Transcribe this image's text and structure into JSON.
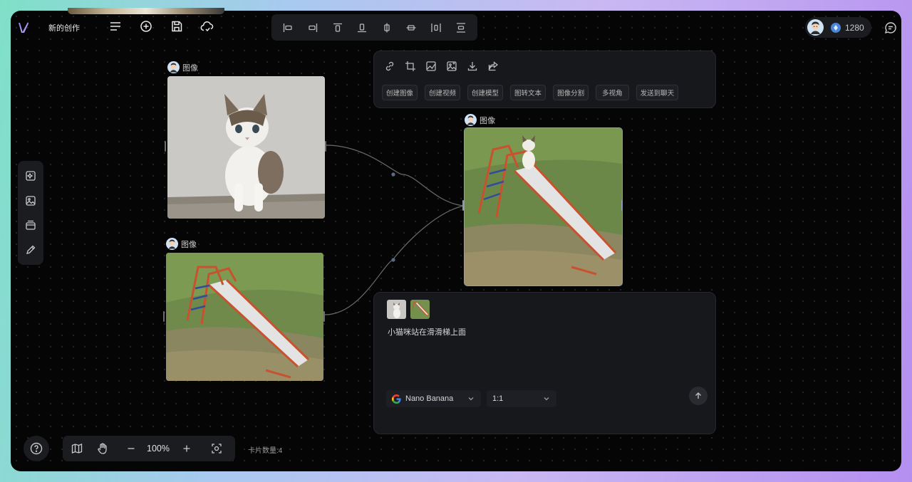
{
  "app": {
    "title": "新的创作"
  },
  "credits": {
    "count": "1280"
  },
  "cards": [
    {
      "label": "图像"
    },
    {
      "label": "图像"
    },
    {
      "label": "图像"
    }
  ],
  "image_toolbar": {
    "icons": [
      "link-icon",
      "crop-icon",
      "image-edit-icon",
      "image-expand-icon",
      "download-icon",
      "share-icon"
    ],
    "actions": [
      "创建图像",
      "创建视频",
      "创建模型",
      "图转文本",
      "图像分割",
      "多视角",
      "发送到聊天"
    ]
  },
  "prompt": {
    "text": "小猫咪站在滑滑梯上面",
    "model": "Nano Banana",
    "ratio": "1:1"
  },
  "zoom": {
    "value": "100%"
  },
  "footer": {
    "card_count": "卡片数量:4"
  },
  "colors": {
    "background": "#050505",
    "panel": "#17181c",
    "selection": "#6ea6d6",
    "accent_gradient": [
      "#7fe0c8",
      "#b58ff0"
    ]
  }
}
